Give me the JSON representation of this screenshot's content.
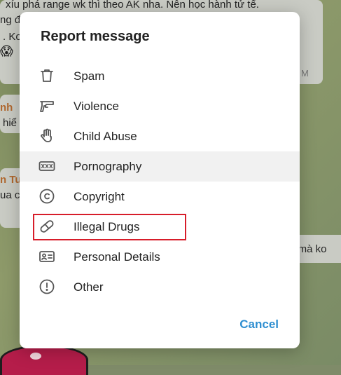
{
  "background": {
    "line1": "xíu phá range wk thì theo AK nha. Nên học hành tử tế.",
    "line2": "ng đề",
    "line3": ". Ko",
    "line4": "M",
    "sender1": "nh",
    "line5": "hiể",
    "sender2": "n Tu",
    "line6": "ua c",
    "right_text": "ót mà ko"
  },
  "dialog": {
    "title": "Report message",
    "items": [
      {
        "label": "Spam",
        "icon": "trash-icon"
      },
      {
        "label": "Violence",
        "icon": "gun-icon"
      },
      {
        "label": "Child Abuse",
        "icon": "hand-icon"
      },
      {
        "label": "Pornography",
        "icon": "xxx-icon"
      },
      {
        "label": "Copyright",
        "icon": "copyright-icon"
      },
      {
        "label": "Illegal Drugs",
        "icon": "pill-icon"
      },
      {
        "label": "Personal Details",
        "icon": "id-card-icon"
      },
      {
        "label": "Other",
        "icon": "info-icon"
      }
    ],
    "cancel_label": "Cancel"
  },
  "colors": {
    "accent": "#2f8fd1",
    "highlight_box": "#d71d2a",
    "hover_row": "#f1f1f1"
  }
}
